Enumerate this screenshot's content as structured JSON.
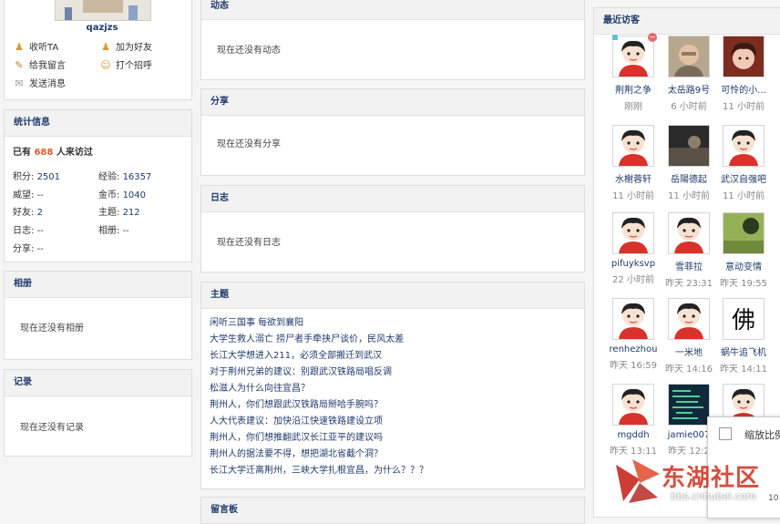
{
  "profile": {
    "username": "qazjzs",
    "actions": [
      "收听TA",
      "加为好友",
      "给我留言",
      "打个招呼",
      "发送消息"
    ]
  },
  "stats": {
    "title": "统计信息",
    "visits_prefix": "已有",
    "visits_count": "688",
    "visits_suffix": "人来访过",
    "items": [
      {
        "label": "积分:",
        "value": "2501"
      },
      {
        "label": "经验:",
        "value": "16357"
      },
      {
        "label": "威望:",
        "value": "--"
      },
      {
        "label": "金币:",
        "value": "1040"
      },
      {
        "label": "好友:",
        "value": "2"
      },
      {
        "label": "主题:",
        "value": "212"
      },
      {
        "label": "日志:",
        "value": "--"
      },
      {
        "label": "相册:",
        "value": "--"
      },
      {
        "label": "分享:",
        "value": "--"
      }
    ]
  },
  "album": {
    "title": "相册",
    "empty": "现在还没有相册"
  },
  "records": {
    "title": "记录",
    "empty": "现在还没有记录"
  },
  "dynamics": {
    "title": "动态",
    "empty": "现在还没有动态"
  },
  "share": {
    "title": "分享",
    "empty": "现在还没有分享"
  },
  "blog": {
    "title": "日志",
    "empty": "现在还没有日志"
  },
  "topics": {
    "title": "主题",
    "items": [
      "闲听三国事 每欲到襄阳",
      "大学生救人溺亡 捞尸者手牵挟尸谈价，民风太差",
      "长江大学想进入211，必须全部搬迁到武汉",
      "对于荆州兄弟的建议：别跟武汉铁路局唱反调",
      "松滋人为什么向往宜昌？",
      "荆州人，你们想跟武汉铁路局掰哈手腕吗？",
      "人大代表建议：加快沿江快速铁路建设立项",
      "荆州人，你们想推翻武汉长江亚平的建议吗",
      "荆州人的据法要不得，想把湖北省截个洞？",
      "长江大学迁离荆州，三峡大学扎根宜昌，为什么？？？"
    ],
    "next_title": "留言板"
  },
  "visitors": {
    "title": "最近访客",
    "items": [
      {
        "name": "荆荆之争",
        "time": "刚刚",
        "avatar": "default"
      },
      {
        "name": "太岳路9号",
        "time": "6 小时前",
        "avatar": "photo-man"
      },
      {
        "name": "可怜的小...",
        "time": "11 小时前",
        "avatar": "photo-girl"
      },
      {
        "name": "水榭蓉轩",
        "time": "11 小时前",
        "avatar": "default"
      },
      {
        "name": "岳陽德起",
        "time": "11 小时前",
        "avatar": "photo-dark"
      },
      {
        "name": "武汉自强吧",
        "time": "11 小时前",
        "avatar": "default"
      },
      {
        "name": "pifuyksvp",
        "time": "22 小时前",
        "avatar": "default"
      },
      {
        "name": "雪菲拉",
        "time": "昨天 23:31",
        "avatar": "default"
      },
      {
        "name": "意动变情",
        "time": "昨天 19:55",
        "avatar": "photo-green"
      },
      {
        "name": "renhezhou",
        "time": "昨天 16:59",
        "avatar": "default"
      },
      {
        "name": "一米地",
        "time": "昨天 14:16",
        "avatar": "default"
      },
      {
        "name": "蜗牛追飞机",
        "time": "昨天 14:11",
        "avatar": "calligraphy"
      },
      {
        "name": "mgddh",
        "time": "昨天 13:11",
        "avatar": "default"
      },
      {
        "name": "jamie007",
        "time": "昨天 12:2",
        "avatar": "photo-code"
      },
      {
        "name": "",
        "time": "",
        "avatar": "default"
      }
    ]
  },
  "overlay": {
    "zoom_label": "缩放比例",
    "zoom_value": "10"
  },
  "watermark": {
    "text": "东湖社区",
    "url": "bbs.cnhubei.com"
  },
  "colors": {
    "link": "#1f3a6b",
    "accent": "#e05a2b",
    "panel_bg": "#f2f2f2"
  }
}
